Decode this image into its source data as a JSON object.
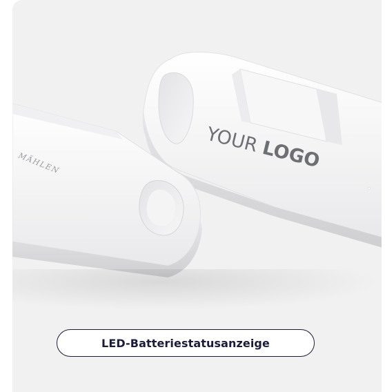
{
  "product_image": {
    "logo_regular": "YOUR ",
    "logo_bold": "LOGO",
    "engraving": "MÄHLEN"
  },
  "cta": {
    "label": "LED-Batteriestatusanzeige"
  },
  "colors": {
    "card_background": "#f1f1f2",
    "button_border": "#1b1b3a",
    "button_text": "#1b1b3a",
    "device_white": "#fafafa",
    "device_shadow": "#dcdcdf"
  }
}
